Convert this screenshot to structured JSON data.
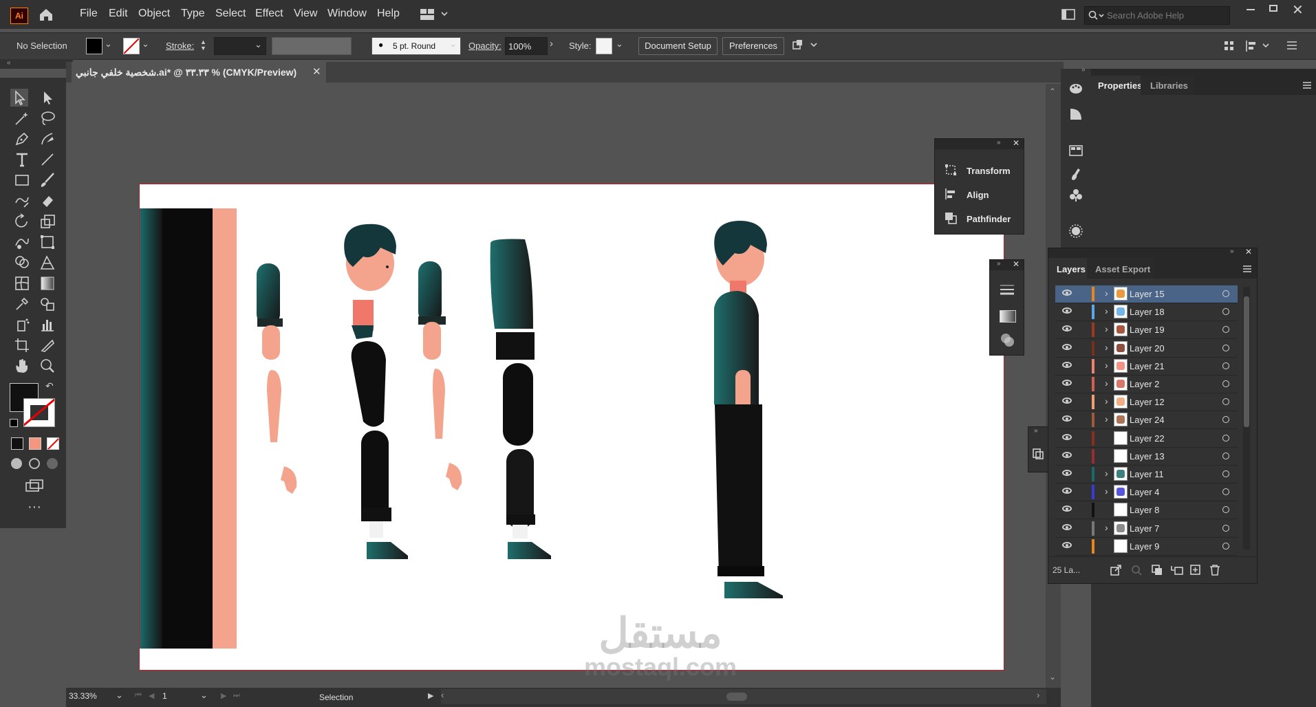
{
  "app": {
    "logo": "Ai"
  },
  "menu": [
    "File",
    "Edit",
    "Object",
    "Type",
    "Select",
    "Effect",
    "View",
    "Window",
    "Help"
  ],
  "search": {
    "placeholder": "Search Adobe Help"
  },
  "control": {
    "selection": "No Selection",
    "stroke_label": "Stroke:",
    "brush": "5 pt. Round",
    "opacity_label": "Opacity:",
    "opacity_value": "100%",
    "style_label": "Style:",
    "document_setup": "Document Setup",
    "preferences": "Preferences"
  },
  "document": {
    "tab_title": "شخصية خلفي جانبي.ai* @ ٣٣.٣٣ % (CMYK/Preview)"
  },
  "status": {
    "zoom": "33.33%",
    "artboard": "1",
    "tool": "Selection"
  },
  "floating_panel": {
    "items": [
      "Transform",
      "Align",
      "Pathfinder"
    ]
  },
  "properties": {
    "tabs": [
      "Properties",
      "Libraries"
    ]
  },
  "layers": {
    "tabs": [
      "Layers",
      "Asset Export"
    ],
    "rows": [
      {
        "name": "Layer 15",
        "color": "#e8861c",
        "expand": true,
        "selected": true
      },
      {
        "name": "Layer 18",
        "color": "#5aa9e6",
        "expand": true
      },
      {
        "name": "Layer 19",
        "color": "#9b3a1f",
        "expand": true
      },
      {
        "name": "Layer 20",
        "color": "#7a2f1b",
        "expand": true
      },
      {
        "name": "Layer 21",
        "color": "#f08070",
        "expand": true
      },
      {
        "name": "Layer 2",
        "color": "#d06050",
        "expand": true
      },
      {
        "name": "Layer 12",
        "color": "#f0a070",
        "expand": true
      },
      {
        "name": "Layer 24",
        "color": "#a05a3a",
        "expand": true
      },
      {
        "name": "Layer 22",
        "color": "#8a2f1e",
        "expand": false
      },
      {
        "name": "Layer 13",
        "color": "#9a2e2e",
        "expand": false
      },
      {
        "name": "Layer 11",
        "color": "#1a6a6a",
        "expand": true
      },
      {
        "name": "Layer 4",
        "color": "#3a3ad8",
        "expand": true
      },
      {
        "name": "Layer 8",
        "color": "#111111",
        "expand": false
      },
      {
        "name": "Layer 7",
        "color": "#777777",
        "expand": true
      },
      {
        "name": "Layer 9",
        "color": "#e8861c",
        "expand": false
      }
    ],
    "count": "25 La..."
  },
  "watermark": {
    "arabic": "مستقل",
    "latin": "mostaql.com"
  }
}
